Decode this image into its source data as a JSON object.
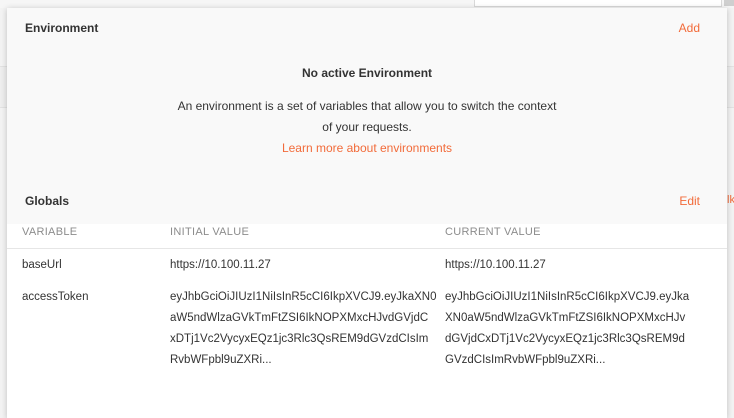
{
  "environment": {
    "title": "Environment",
    "add_label": "Add",
    "no_active_title": "No active Environment",
    "description": "An environment is a set of variables that allow you to switch the context of your requests.",
    "learn_more": "Learn more about environments"
  },
  "globals": {
    "title": "Globals",
    "edit_label": "Edit",
    "columns": {
      "variable": "VARIABLE",
      "initial": "INITIAL VALUE",
      "current": "CURRENT VALUE"
    },
    "rows": [
      {
        "variable": "baseUrl",
        "initial": "https://10.100.11.27",
        "current": "https://10.100.11.27"
      },
      {
        "variable": "accessToken",
        "initial_lines": [
          "eyJhbGciOiJIUzI1NiIsInR5cCI6IkpXVCJ9.eyJkaXN0",
          "aW5ndWlzaGVkTmFtZSI6IkNOPXMxcHJvdGVjdC",
          "xDTj1Vc2VycyxEQz1jc3Rlc3QsREM9dGVzdCIsIm",
          "RvbWFpbl9uZXRi..."
        ],
        "current_lines": [
          "eyJhbGciOiJIUzI1NiIsInR5cCI6IkpXVCJ9.eyJka",
          "XN0aW5ndWlzaGVkTmFtZSI6IkNOPXMxcHJv",
          "dGVjdCxDTj1Vc2VycyxEQz1jc3Rlc3QsREM9d",
          "GVzdCIsImRvbWFpbl9uZXRi..."
        ]
      }
    ]
  },
  "background": {
    "peek_text": "lk"
  },
  "colors": {
    "accent": "#f26b3a",
    "text": "#333333",
    "muted": "#8c8c8c"
  }
}
